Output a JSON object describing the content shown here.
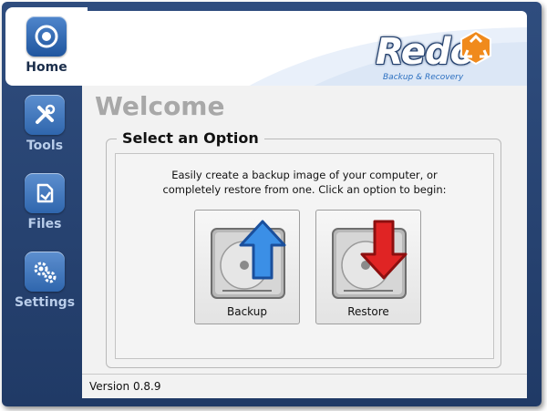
{
  "app": {
    "logo_name": "Redo",
    "logo_tagline": "Backup & Recovery"
  },
  "sidebar": {
    "items": [
      {
        "label": "Home",
        "icon": "home-icon",
        "active": true
      },
      {
        "label": "Tools",
        "icon": "tools-icon",
        "active": false
      },
      {
        "label": "Files",
        "icon": "files-icon",
        "active": false
      },
      {
        "label": "Settings",
        "icon": "gears-icon",
        "active": false
      }
    ]
  },
  "main": {
    "title": "Welcome",
    "group_title": "Select an Option",
    "intro_line1": "Easily create a backup image of your computer, or",
    "intro_line2": "completely restore from one. Click an option to begin:",
    "actions": [
      {
        "label": "Backup",
        "icon": "drive-upload-arrow-icon",
        "arrow_color": "#2f86e0"
      },
      {
        "label": "Restore",
        "icon": "drive-download-arrow-icon",
        "arrow_color": "#e02020"
      }
    ]
  },
  "footer": {
    "version": "Version 0.8.9"
  },
  "colors": {
    "sidebar_bg": "#2a4674",
    "accent_blue": "#2f66ad",
    "logo_orange": "#f08a1c"
  }
}
